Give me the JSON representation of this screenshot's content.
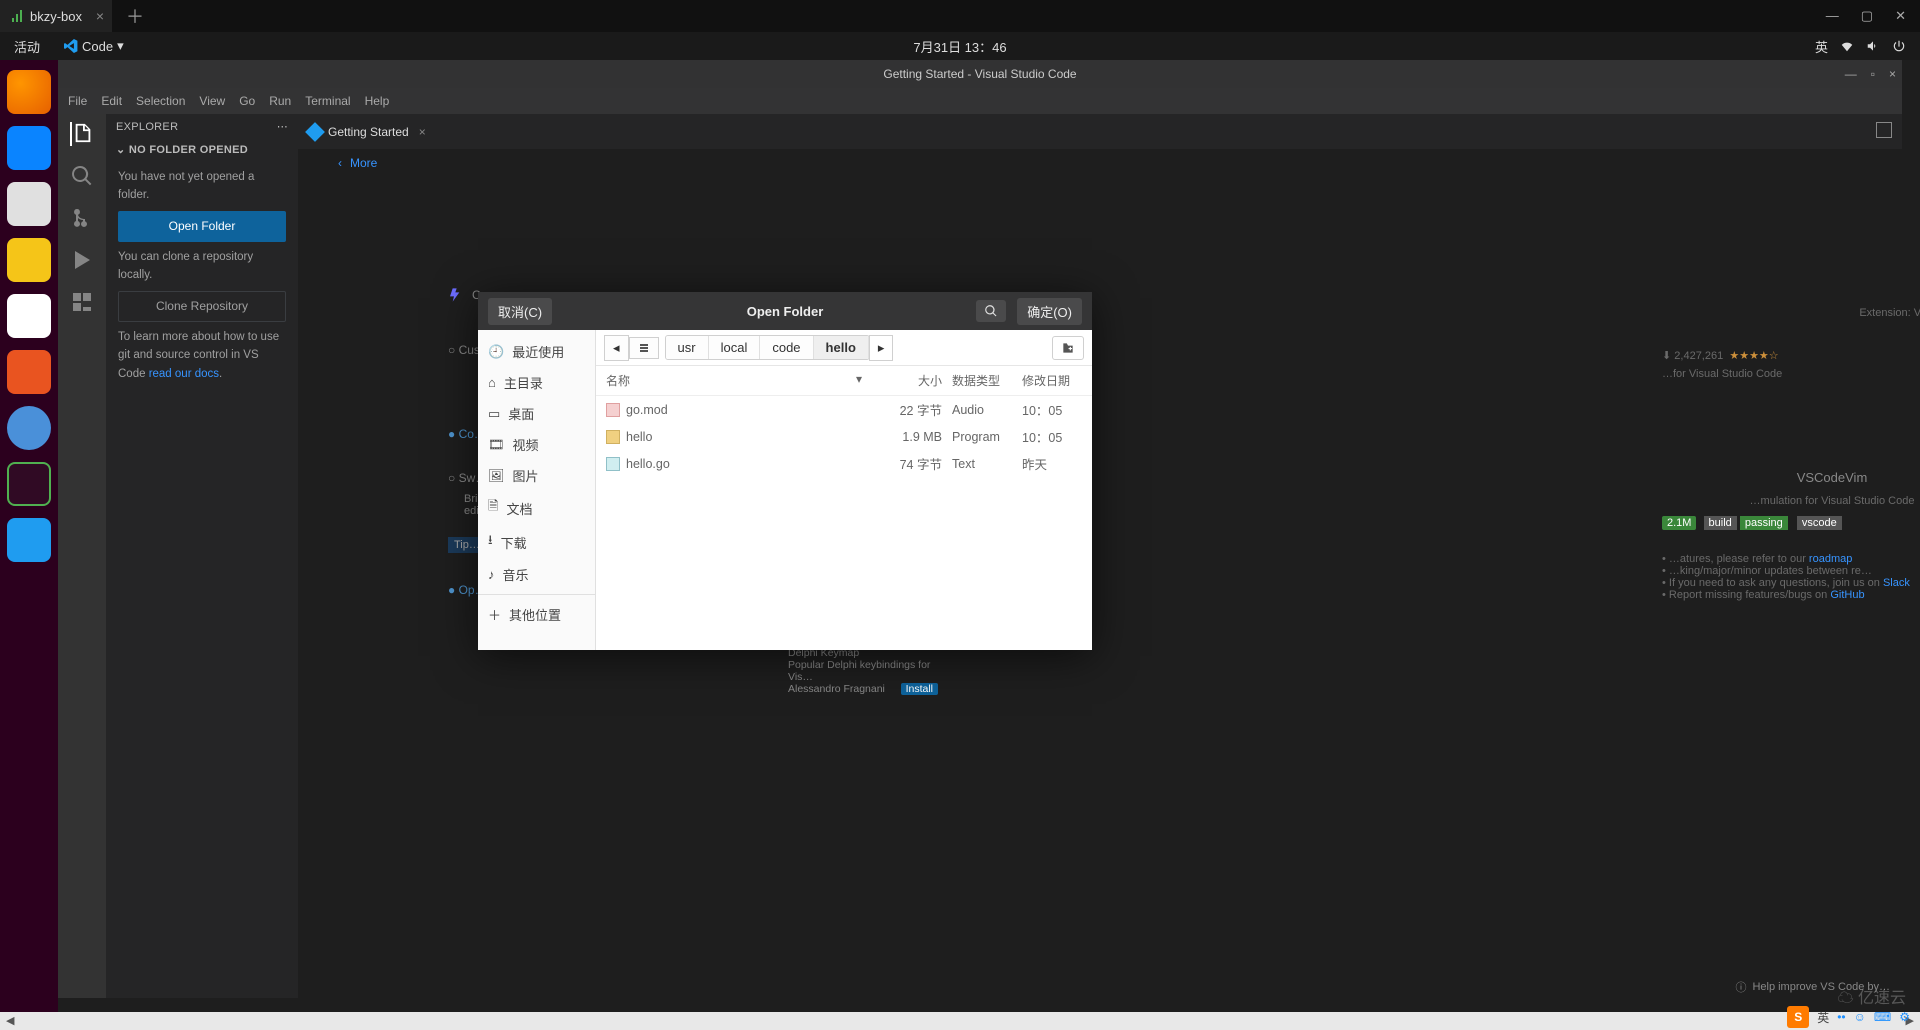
{
  "browser_tab": {
    "title": "bkzy-box"
  },
  "gnome": {
    "activities": "活动",
    "app_label": "Code",
    "clock": "7月31日 13：46",
    "ime_label": "英"
  },
  "vscode": {
    "title": "Getting Started - Visual Studio Code",
    "menus": [
      "File",
      "Edit",
      "Selection",
      "View",
      "Go",
      "Run",
      "Terminal",
      "Help"
    ],
    "sidebar": {
      "header": "EXPLORER",
      "section": "NO FOLDER OPENED",
      "msg1": "You have not yet opened a folder.",
      "open_btn": "Open Folder",
      "msg2": "You can clone a repository locally.",
      "clone_btn": "Clone Repository",
      "msg3a": "To learn more about how to use git and source control in VS Code ",
      "msg3_link": "read our docs",
      "msg3b": "."
    },
    "tab": "Getting Started",
    "more": "More",
    "checklist": [
      "C…",
      "Cus…",
      "Co…",
      "Sw…",
      "Op…"
    ],
    "bg_notes": [
      "Bri…",
      "edi…",
      "Tip…"
    ],
    "status_hint": "Help improve VS Code by…",
    "ext_panel": {
      "name": "VSCodeVim",
      "desc": "…mulation for Visual Studio Code",
      "count_label": "2,427,261",
      "badge1": "build",
      "badge2": "vscode",
      "list_head": "Delphi Keymap",
      "list_sub": "Popular Delphi keybindings for Vis…",
      "author": "Alessandro Fragnani",
      "install": "Install"
    }
  },
  "dialog": {
    "cancel": "取消(C)",
    "ok": "确定(O)",
    "title": "Open Folder",
    "places": [
      {
        "label": "最近使用",
        "icon": "clock-icon"
      },
      {
        "label": "主目录",
        "icon": "home-icon"
      },
      {
        "label": "桌面",
        "icon": "desktop-icon"
      },
      {
        "label": "视频",
        "icon": "video-icon"
      },
      {
        "label": "图片",
        "icon": "image-icon"
      },
      {
        "label": "文档",
        "icon": "document-icon"
      },
      {
        "label": "下载",
        "icon": "download-icon"
      },
      {
        "label": "音乐",
        "icon": "music-icon"
      },
      {
        "label": "其他位置",
        "icon": "plus-icon"
      }
    ],
    "path": [
      "usr",
      "local",
      "code",
      "hello"
    ],
    "cols": {
      "name": "名称",
      "size": "大小",
      "type": "数据类型",
      "date": "修改日期"
    },
    "rows": [
      {
        "name": "go.mod",
        "size": "22 字节",
        "type": "Audio",
        "date": "10：05",
        "kind": "audio"
      },
      {
        "name": "hello",
        "size": "1.9 MB",
        "type": "Program",
        "date": "10：05",
        "kind": "folder"
      },
      {
        "name": "hello.go",
        "size": "74 字节",
        "type": "Text",
        "date": "昨天",
        "kind": "text"
      }
    ]
  },
  "tray_bottom": {
    "ime": "英"
  },
  "watermark": "亿速云"
}
